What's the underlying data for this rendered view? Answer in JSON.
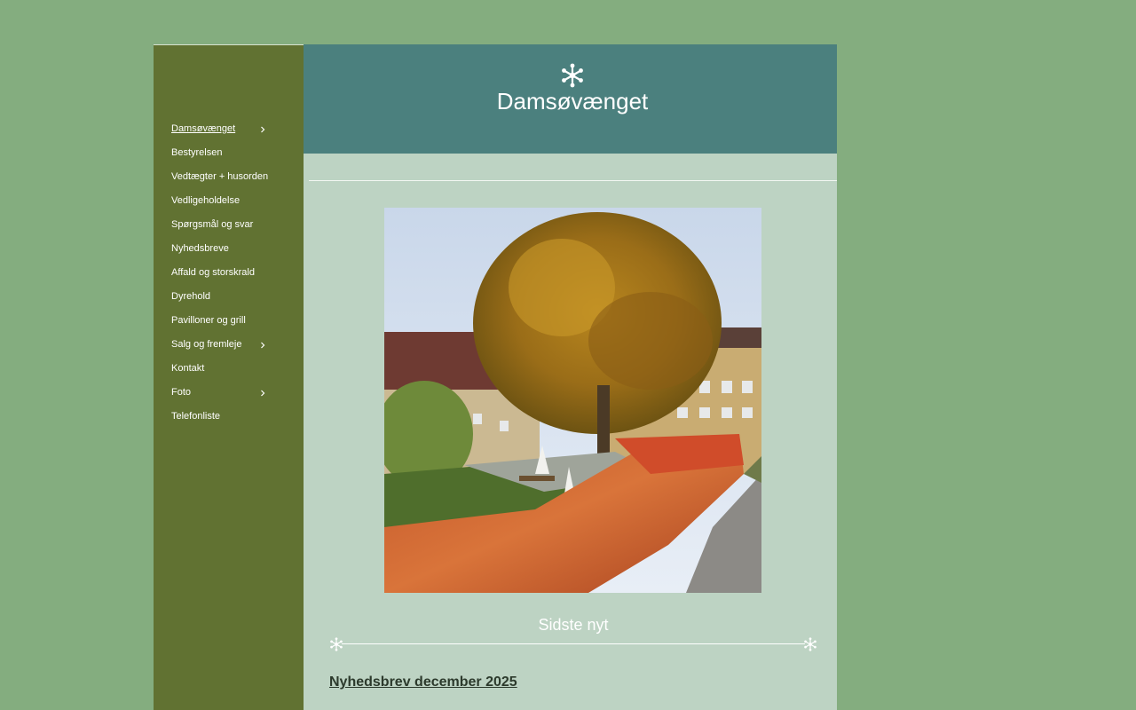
{
  "site": {
    "title": "Damsøvænget"
  },
  "nav": {
    "items": [
      {
        "label": "Damsøvænget",
        "has_submenu": true,
        "active": true
      },
      {
        "label": "Bestyrelsen",
        "has_submenu": false
      },
      {
        "label": "Vedtægter + husorden",
        "has_submenu": false
      },
      {
        "label": "Vedligeholdelse",
        "has_submenu": false
      },
      {
        "label": "Spørgsmål og svar",
        "has_submenu": false
      },
      {
        "label": "Nyhedsbreve",
        "has_submenu": false
      },
      {
        "label": "Affald og storskrald",
        "has_submenu": false
      },
      {
        "label": "Dyrehold",
        "has_submenu": false
      },
      {
        "label": "Pavilloner og grill",
        "has_submenu": false
      },
      {
        "label": "Salg og fremleje",
        "has_submenu": true
      },
      {
        "label": "Kontakt",
        "has_submenu": false
      },
      {
        "label": "Foto",
        "has_submenu": true
      },
      {
        "label": "Telefonliste",
        "has_submenu": false
      }
    ]
  },
  "main": {
    "section_title": "Sidste nyt",
    "news_link": "Nyhedsbrev december 2025"
  },
  "colors": {
    "background": "#84ad7f",
    "sidebar": "#617232",
    "header": "#4b807e",
    "content": "#bdd3c3"
  },
  "icons": {
    "header": "snowflake-icon",
    "ornament": "snowflake-icon",
    "submenu": "chevron-right-icon"
  }
}
